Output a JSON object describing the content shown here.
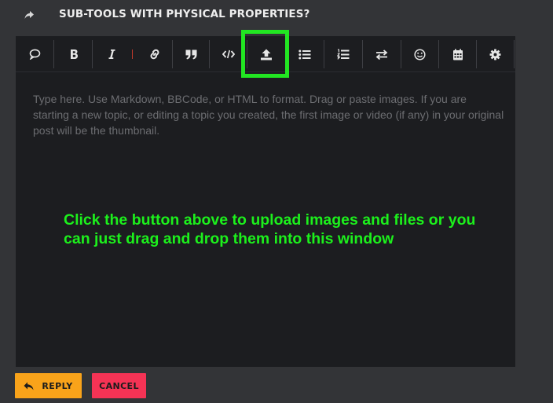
{
  "header": {
    "title": "SUB-TOOLS WITH PHYSICAL PROPERTIES?",
    "reply_icon": "share-arrow-icon"
  },
  "toolbar": {
    "buttons": [
      {
        "name": "quote-bubble-icon"
      },
      {
        "name": "bold-icon",
        "glyph": "B"
      },
      {
        "name": "italic-icon",
        "glyph": "I"
      },
      {
        "name": "link-icon"
      },
      {
        "name": "blockquote-icon"
      },
      {
        "name": "code-icon"
      },
      {
        "name": "upload-icon"
      },
      {
        "name": "bullet-list-icon"
      },
      {
        "name": "numbered-list-icon"
      },
      {
        "name": "swap-icon"
      },
      {
        "name": "emoji-icon"
      },
      {
        "name": "calendar-icon"
      },
      {
        "name": "gear-icon"
      }
    ],
    "highlight_color": "#22e622"
  },
  "composer": {
    "placeholder": "Type here. Use Markdown, BBCode, or HTML to format. Drag or paste images. If you are starting a new topic, or editing a topic you created, the first image or video (if any) in your original post will be the thumbnail."
  },
  "annotation": {
    "text": "Click the button above to upload images and files or you can just drag and drop them into this window",
    "color": "#1cf01c"
  },
  "footer": {
    "reply_label": "REPLY",
    "cancel_label": "CANCEL",
    "reply_color": "#f9a31a",
    "cancel_color": "#f53355"
  }
}
